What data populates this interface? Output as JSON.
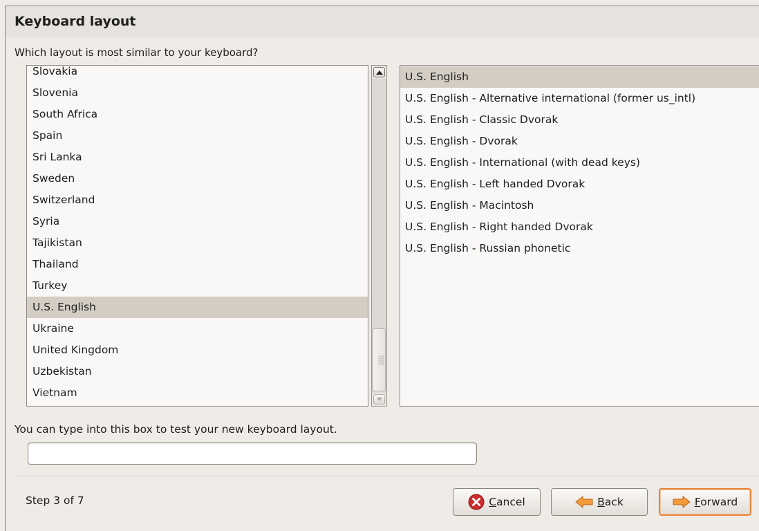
{
  "title": "Keyboard layout",
  "prompt": "Which layout is most similar to your keyboard?",
  "countries": {
    "items": [
      "Slovakia",
      "Slovenia",
      "South Africa",
      "Spain",
      "Sri Lanka",
      "Sweden",
      "Switzerland",
      "Syria",
      "Tajikistan",
      "Thailand",
      "Turkey",
      "U.S. English",
      "Ukraine",
      "United Kingdom",
      "Uzbekistan",
      "Vietnam"
    ],
    "selected": "U.S. English"
  },
  "variants": {
    "items": [
      "U.S. English",
      "U.S. English - Alternative international (former us_intl)",
      "U.S. English - Classic Dvorak",
      "U.S. English - Dvorak",
      "U.S. English - International (with dead keys)",
      "U.S. English - Left handed Dvorak",
      "U.S. English - Macintosh",
      "U.S. English - Right handed Dvorak",
      "U.S. English - Russian phonetic"
    ],
    "selected": "U.S. English"
  },
  "test": {
    "label": "You can type into this box to test your new keyboard layout.",
    "value": ""
  },
  "footer": {
    "step": "Step 3 of 7",
    "cancel_mn": "C",
    "cancel_rest": "ancel",
    "back_mn": "B",
    "back_rest": "ack",
    "forward_mn": "F",
    "forward_rest": "orward"
  },
  "colors": {
    "selection": "#d4cdc4",
    "cancel_icon": "#cc2b2b",
    "arrow_icon": "#f29a3c",
    "forward_focus": "#e6843a"
  },
  "icons": {
    "cancel": "cancel-icon",
    "back": "arrow-left-icon",
    "forward": "arrow-right-icon",
    "scroll_up": "scroll-up-icon",
    "scroll_down": "scroll-down-icon"
  }
}
